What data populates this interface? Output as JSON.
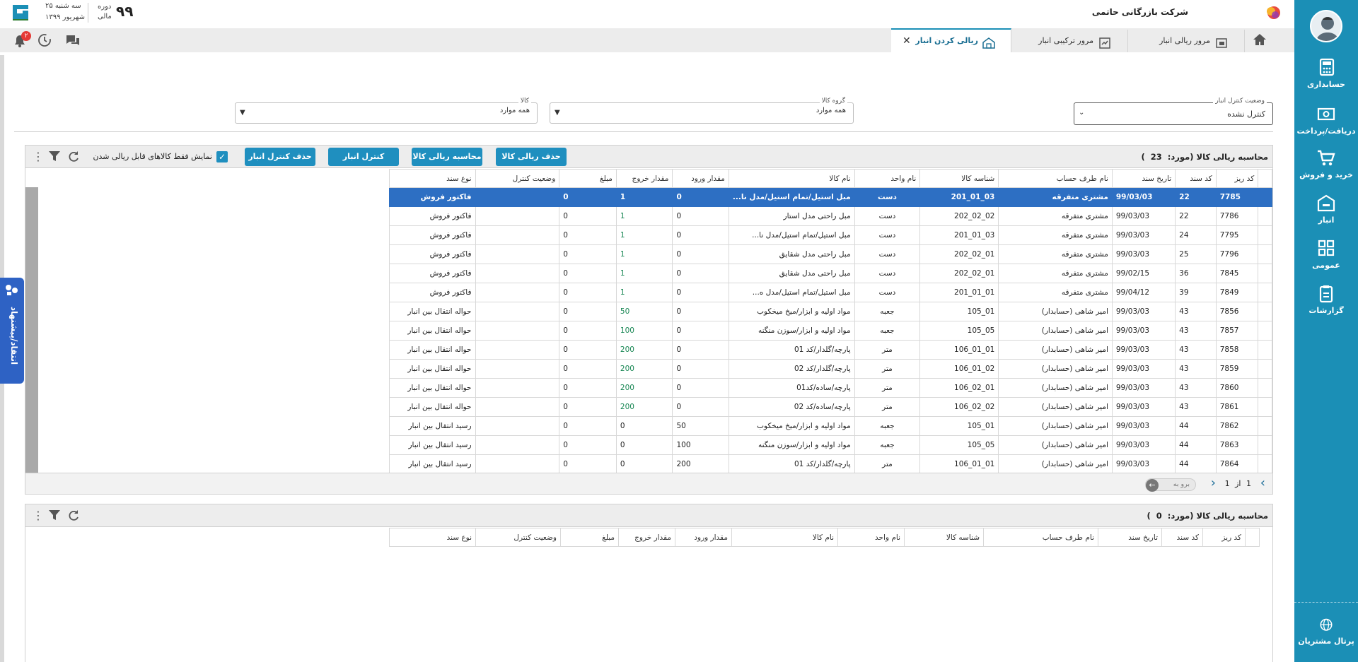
{
  "company": {
    "name": "شرکت بازرگانی حاتمی"
  },
  "period": {
    "label_line1": "دوره",
    "label_line2": "مالی",
    "year": "۹۹",
    "weekday": "سه شنبه ۲۵",
    "month": "شهریور ۱۳۹۹"
  },
  "notifications": {
    "count": "۲"
  },
  "tabs": [
    {
      "label": "مرور ریالی انبار"
    },
    {
      "label": "مرور ترکیبی انبار"
    },
    {
      "label": "ریالی کردن انبار"
    }
  ],
  "sidebar": {
    "items": [
      {
        "label": "حسابداری",
        "icon": "calculator-icon"
      },
      {
        "label": "دریافت/پرداخت",
        "icon": "money-icon"
      },
      {
        "label": "خرید و فروش",
        "icon": "cart-icon"
      },
      {
        "label": "انبار",
        "icon": "warehouse-icon"
      },
      {
        "label": "عمومی",
        "icon": "grid-icon"
      },
      {
        "label": "گزارشات",
        "icon": "clipboard-icon"
      }
    ],
    "portal": "پرتال مشتریان"
  },
  "feedback": {
    "label": "انتقاد/پیشنهاد"
  },
  "filters": {
    "status": {
      "label": "وضعیت کنترل انبار",
      "value": "کنترل نشده"
    },
    "group": {
      "label": "گروه کالا",
      "value": "همه موارد"
    },
    "item": {
      "label": "کالا",
      "value": "همه موارد"
    }
  },
  "panel1": {
    "title": "محاسبه ریالی کالا (مورد:",
    "count": "23",
    "close_paren": ")",
    "buttons": {
      "delete_rial": "حذف ریالی کالا",
      "calc_rial": "محاسبه ریالی کالا",
      "control": "کنترل انبار",
      "delete_control": "حذف کنترل انبار"
    },
    "checkbox_label": "نمایش فقط کالاهای قابل ریالی شدن",
    "columns": [
      "کد ریز",
      "کد سند",
      "تاریخ سند",
      "نام طرف حساب",
      "شناسه کالا",
      "نام واحد",
      "نام کالا",
      "مقدار ورود",
      "مقدار خروج",
      "مبلغ",
      "وضعیت کنترل",
      "نوع سند"
    ],
    "rows": [
      [
        "7785",
        "22",
        "99/03/03",
        "مشتری متفرقه",
        "03_01_201",
        "دست",
        "مبل استیل/تمام استیل/مدل نا...",
        "0",
        "1",
        "0",
        "",
        "فاکتور فروش"
      ],
      [
        "7786",
        "22",
        "99/03/03",
        "مشتری متفرقه",
        "02_02_202",
        "دست",
        "مبل راحتی مدل استار",
        "0",
        "1",
        "0",
        "",
        "فاکتور فروش"
      ],
      [
        "7795",
        "24",
        "99/03/03",
        "مشتری متفرقه",
        "03_01_201",
        "دست",
        "مبل استیل/تمام استیل/مدل نا...",
        "0",
        "1",
        "0",
        "",
        "فاکتور فروش"
      ],
      [
        "7796",
        "25",
        "99/03/03",
        "مشتری متفرقه",
        "01_02_202",
        "دست",
        "مبل راحتی مدل شقایق",
        "0",
        "1",
        "0",
        "",
        "فاکتور فروش"
      ],
      [
        "7845",
        "36",
        "99/02/15",
        "مشتری متفرقه",
        "01_02_202",
        "دست",
        "مبل راحتی مدل شقایق",
        "0",
        "1",
        "0",
        "",
        "فاکتور فروش"
      ],
      [
        "7849",
        "39",
        "99/04/12",
        "مشتری متفرقه",
        "01_01_201",
        "دست",
        "مبل استیل/تمام استیل/مدل ه...",
        "0",
        "1",
        "0",
        "",
        "فاکتور فروش"
      ],
      [
        "7856",
        "43",
        "99/03/03",
        "امیر شاهی (حسابدار)",
        "01_105",
        "جعبه",
        "مواد اولیه و ابزار/میخ میخکوب",
        "0",
        "50",
        "0",
        "",
        "حواله انتقال بین انبار"
      ],
      [
        "7857",
        "43",
        "99/03/03",
        "امیر شاهی (حسابدار)",
        "05_105",
        "جعبه",
        "مواد اولیه و ابزار/سوزن منگنه",
        "0",
        "100",
        "0",
        "",
        "حواله انتقال بین انبار"
      ],
      [
        "7858",
        "43",
        "99/03/03",
        "امیر شاهی (حسابدار)",
        "01_01_106",
        "متر",
        "پارچه/گلدار/کد 01",
        "0",
        "200",
        "0",
        "",
        "حواله انتقال بین انبار"
      ],
      [
        "7859",
        "43",
        "99/03/03",
        "امیر شاهی (حسابدار)",
        "02_01_106",
        "متر",
        "پارچه/گلدار/کد 02",
        "0",
        "200",
        "0",
        "",
        "حواله انتقال بین انبار"
      ],
      [
        "7860",
        "43",
        "99/03/03",
        "امیر شاهی (حسابدار)",
        "01_02_106",
        "متر",
        "پارچه/ساده/کد01",
        "0",
        "200",
        "0",
        "",
        "حواله انتقال بین انبار"
      ],
      [
        "7861",
        "43",
        "99/03/03",
        "امیر شاهی (حسابدار)",
        "02_02_106",
        "متر",
        "پارچه/ساده/کد 02",
        "0",
        "200",
        "0",
        "",
        "حواله انتقال بین انبار"
      ],
      [
        "7862",
        "44",
        "99/03/03",
        "امیر شاهی (حسابدار)",
        "01_105",
        "جعبه",
        "مواد اولیه و ابزار/میخ میخکوب",
        "50",
        "0",
        "0",
        "",
        "رسید انتقال بین انبار"
      ],
      [
        "7863",
        "44",
        "99/03/03",
        "امیر شاهی (حسابدار)",
        "05_105",
        "جعبه",
        "مواد اولیه و ابزار/سوزن منگنه",
        "100",
        "0",
        "0",
        "",
        "رسید انتقال بین انبار"
      ],
      [
        "7864",
        "44",
        "99/03/03",
        "امیر شاهی (حسابدار)",
        "01_01_106",
        "متر",
        "پارچه/گلدار/کد 01",
        "200",
        "0",
        "0",
        "",
        "رسید انتقال بین انبار"
      ]
    ],
    "pager": {
      "page": "1",
      "of": "از",
      "total": "1",
      "goto": "برو به"
    }
  },
  "panel2": {
    "title": "محاسبه ریالی کالا (مورد:",
    "count": "0",
    "close_paren": ")",
    "columns": [
      "کد ریز",
      "کد سند",
      "تاریخ سند",
      "نام طرف حساب",
      "شناسه کالا",
      "نام واحد",
      "نام کالا",
      "مقدار ورود",
      "مقدار خروج",
      "مبلغ",
      "وضعیت کنترل",
      "نوع سند"
    ]
  },
  "colors": {
    "accent": "#1b8fb6",
    "selected_row": "#2d6fc3",
    "button": "#1f8fbf",
    "badge": "#e53935"
  }
}
